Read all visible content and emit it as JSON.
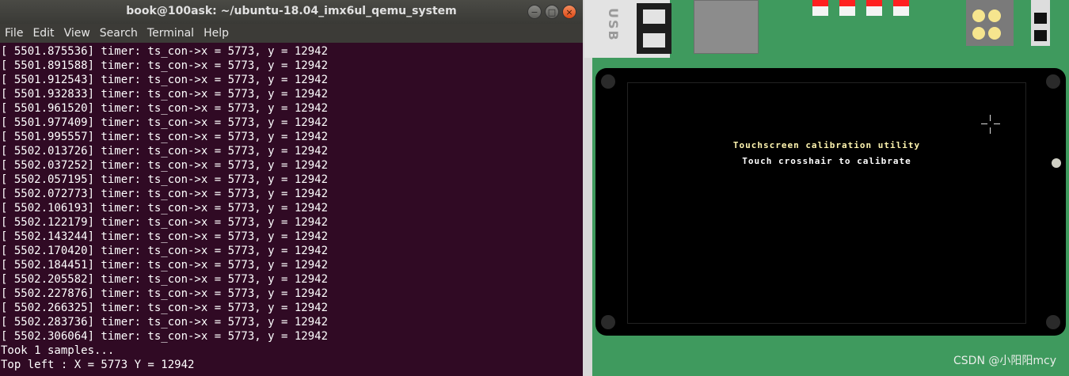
{
  "window": {
    "title": "book@100ask: ~/ubuntu-18.04_imx6ul_qemu_system",
    "controls": [
      "−",
      "□",
      "×"
    ]
  },
  "menu": [
    "File",
    "Edit",
    "View",
    "Search",
    "Terminal",
    "Help"
  ],
  "terminal_lines": [
    "[ 5501.875536] timer: ts_con->x = 5773, y = 12942",
    "[ 5501.891588] timer: ts_con->x = 5773, y = 12942",
    "[ 5501.912543] timer: ts_con->x = 5773, y = 12942",
    "[ 5501.932833] timer: ts_con->x = 5773, y = 12942",
    "[ 5501.961520] timer: ts_con->x = 5773, y = 12942",
    "[ 5501.977409] timer: ts_con->x = 5773, y = 12942",
    "[ 5501.995557] timer: ts_con->x = 5773, y = 12942",
    "[ 5502.013726] timer: ts_con->x = 5773, y = 12942",
    "[ 5502.037252] timer: ts_con->x = 5773, y = 12942",
    "[ 5502.057195] timer: ts_con->x = 5773, y = 12942",
    "[ 5502.072773] timer: ts_con->x = 5773, y = 12942",
    "[ 5502.106193] timer: ts_con->x = 5773, y = 12942",
    "[ 5502.122179] timer: ts_con->x = 5773, y = 12942",
    "[ 5502.143244] timer: ts_con->x = 5773, y = 12942",
    "[ 5502.170420] timer: ts_con->x = 5773, y = 12942",
    "[ 5502.184451] timer: ts_con->x = 5773, y = 12942",
    "[ 5502.205582] timer: ts_con->x = 5773, y = 12942",
    "[ 5502.227876] timer: ts_con->x = 5773, y = 12942",
    "[ 5502.266325] timer: ts_con->x = 5773, y = 12942",
    "[ 5502.283736] timer: ts_con->x = 5773, y = 12942",
    "[ 5502.306064] timer: ts_con->x = 5773, y = 12942",
    "Took 1 samples...",
    "Top left : X = 5773 Y = 12942"
  ],
  "board": {
    "usb_label": "USB",
    "lcd": {
      "title": "Touchscreen calibration utility",
      "subtitle": "Touch crosshair to calibrate",
      "crosshair_icon": "crosshair-icon"
    }
  },
  "watermark": "CSDN @小阳阳mcy",
  "colors": {
    "terminal_bg": "#300a24",
    "board_green": "#3f9a5e",
    "lcd_title": "#fff5b0"
  }
}
